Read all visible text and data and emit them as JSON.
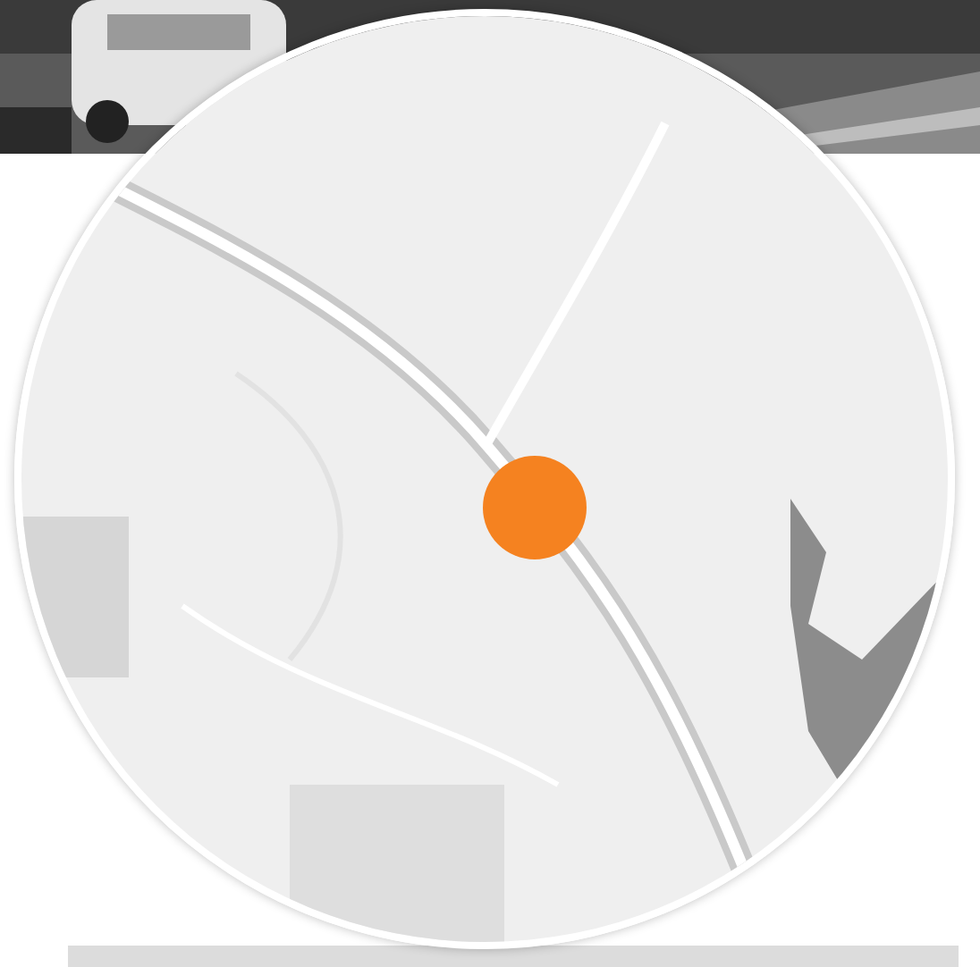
{
  "footer_bar": {
    "kind": "bar"
  }
}
